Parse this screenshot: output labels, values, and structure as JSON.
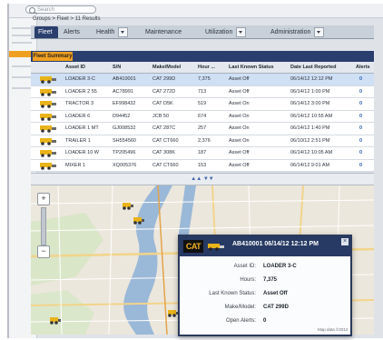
{
  "search": {
    "placeholder": "Search"
  },
  "breadcrumb": "Groups > Fleet > 11 Results",
  "tabs": [
    {
      "label": "Fleet"
    },
    {
      "label": "Alerts"
    },
    {
      "label": "Health"
    },
    {
      "label": "Maintenance"
    },
    {
      "label": "Utilization"
    },
    {
      "label": "Administration"
    }
  ],
  "subtab": {
    "label": "Fleet Summary"
  },
  "table": {
    "headers": [
      "Asset ID",
      "S/N",
      "Make/Model",
      "Hour ...",
      "Last Known Status",
      "Date Last Reported",
      "Alerts"
    ],
    "rows": [
      {
        "asset": "LOADER 3-C",
        "sn": "AB410001",
        "model": "CAT 299D",
        "hours": "7,375",
        "status": "Asset Off",
        "date": "06/14/12 12:12 PM",
        "alerts": "0"
      },
      {
        "asset": "LOADER 2 55",
        "sn": "AC78991",
        "model": "CAT 272D",
        "hours": "713",
        "status": "Asset Off",
        "date": "06/14/12 1:00 PM",
        "alerts": "0"
      },
      {
        "asset": "TRACTOR 3",
        "sn": "EF998432",
        "model": "CAT D5K",
        "hours": "519",
        "status": "Asset On",
        "date": "06/14/12 3:00 PM",
        "alerts": "0"
      },
      {
        "asset": "LOADER 6",
        "sn": "D94452",
        "model": "JCB 50",
        "hours": "674",
        "status": "Asset On",
        "date": "06/14/12 10:55 AM",
        "alerts": "0"
      },
      {
        "asset": "LOADER 1 MT",
        "sn": "GJ008532",
        "model": "CAT 287C",
        "hours": "257",
        "status": "Asset On",
        "date": "06/14/12 1:40 PM",
        "alerts": "0"
      },
      {
        "asset": "TRAILER 1",
        "sn": "SH554560",
        "model": "CAT CT660",
        "hours": "2,376",
        "status": "Asset On",
        "date": "06/10/12 2:51 PM",
        "alerts": "0"
      },
      {
        "asset": "LOADER 10 W",
        "sn": "TP205496",
        "model": "CAT 308K",
        "hours": "187",
        "status": "Asset Off",
        "date": "06/14/12 10:05 AM",
        "alerts": "0"
      },
      {
        "asset": "MIXER 1",
        "sn": "XQ005376",
        "model": "CAT CT660",
        "hours": "153",
        "status": "Asset Off",
        "date": "06/14/12 9:01 AM",
        "alerts": "0"
      }
    ]
  },
  "divider_label": "▲▲ ▼▼",
  "popup": {
    "logo": "CAT",
    "title": "AB410001  06/14/12 12:12 PM",
    "fields": [
      {
        "label": "Asset ID:",
        "value": "LOADER 3-C"
      },
      {
        "label": "Hours:",
        "value": "7,375"
      },
      {
        "label": "Last Known Status:",
        "value": "Asset Off"
      },
      {
        "label": "Make/Model:",
        "value": "CAT 299D"
      },
      {
        "label": "Open Alerts:",
        "value": "0"
      }
    ],
    "close": "×"
  },
  "map_footer": "Map data ©2012",
  "colors": {
    "navy": "#2a3f6e",
    "orange": "#f0a020",
    "cat_yellow": "#e9b41a",
    "water": "#9ab8d8"
  }
}
